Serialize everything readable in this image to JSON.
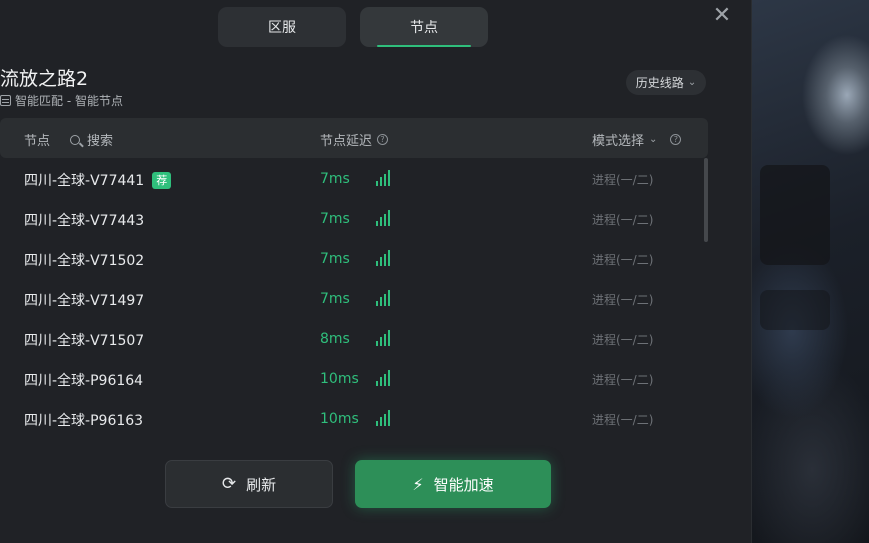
{
  "tabs": {
    "region": "区服",
    "node": "节点"
  },
  "close_glyph": "✕",
  "game": {
    "title": "流放之路2",
    "subtitle": "智能匹配 - 智能节点"
  },
  "history_label": "历史线路",
  "table": {
    "col_node": "节点",
    "search_label": "搜索",
    "col_latency": "节点延迟",
    "col_mode": "模式选择",
    "help_glyph": "?"
  },
  "badge_label": "荐",
  "rows": [
    {
      "name": "四川-全球-V77441",
      "latency": "7ms",
      "mode": "进程(一/二)",
      "recommended": true
    },
    {
      "name": "四川-全球-V77443",
      "latency": "7ms",
      "mode": "进程(一/二)"
    },
    {
      "name": "四川-全球-V71502",
      "latency": "7ms",
      "mode": "进程(一/二)"
    },
    {
      "name": "四川-全球-V71497",
      "latency": "7ms",
      "mode": "进程(一/二)"
    },
    {
      "name": "四川-全球-V71507",
      "latency": "8ms",
      "mode": "进程(一/二)"
    },
    {
      "name": "四川-全球-P96164",
      "latency": "10ms",
      "mode": "进程(一/二)"
    },
    {
      "name": "四川-全球-P96163",
      "latency": "10ms",
      "mode": "进程(一/二)"
    }
  ],
  "buttons": {
    "refresh": "刷新",
    "boost": "智能加速"
  },
  "icons": {
    "refresh": "refresh-icon",
    "boost": "lightning-icon",
    "search": "search-icon",
    "close": "close-icon"
  },
  "colors": {
    "accent": "#2fbf7c",
    "boost_button": "#2d8f58",
    "panel": "#202226"
  }
}
